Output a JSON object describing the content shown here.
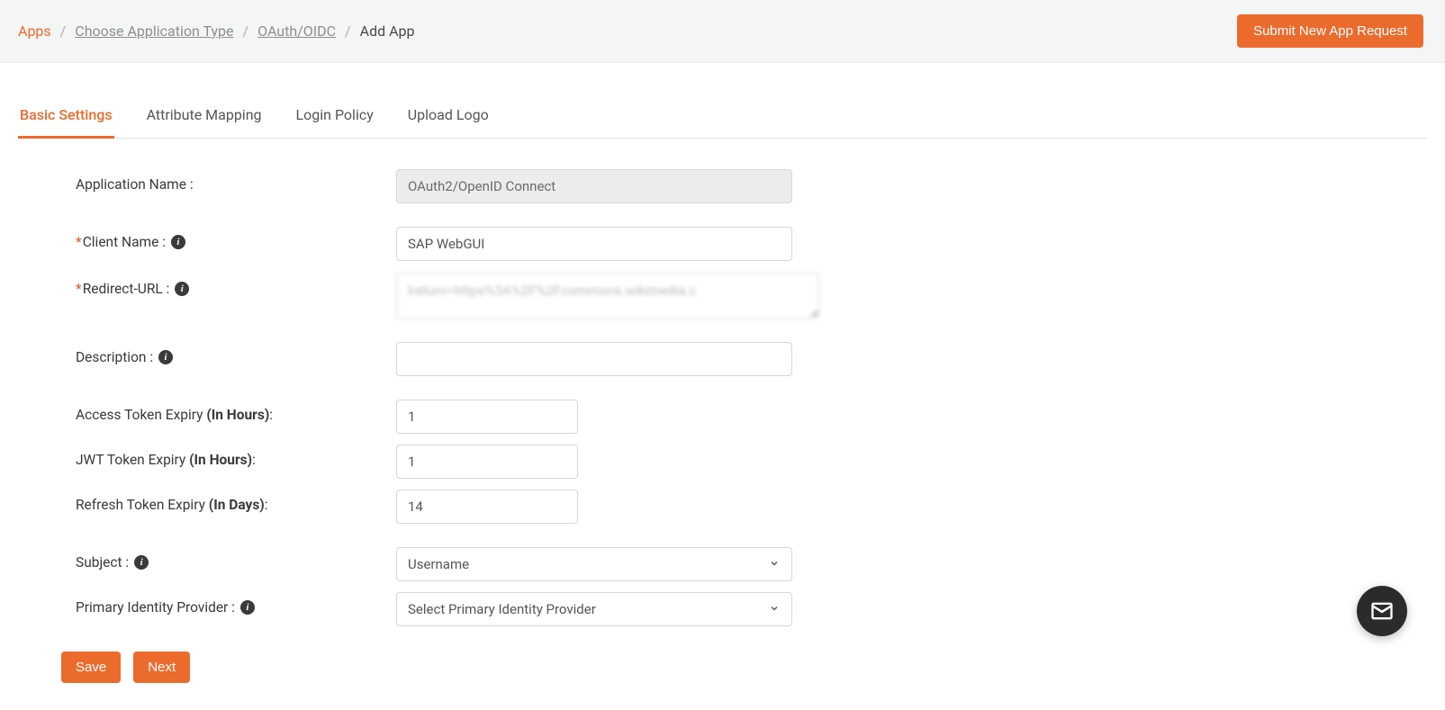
{
  "header": {
    "breadcrumb": {
      "apps": "Apps",
      "choose": "Choose Application Type",
      "oauth": "OAuth/OIDC",
      "current": "Add App",
      "sep": "/"
    },
    "submit_btn": "Submit New App Request"
  },
  "tabs": {
    "basic": "Basic Settings",
    "attribute": "Attribute Mapping",
    "login": "Login Policy",
    "upload": "Upload Logo"
  },
  "form": {
    "app_name": {
      "label": "Application Name :",
      "value": "OAuth2/OpenID Connect"
    },
    "client_name": {
      "label": "Client Name :",
      "value": "SAP WebGUI"
    },
    "redirect_url": {
      "label": "Redirect-URL :",
      "value": "lreturn=https%3A%2F%2Fcommons.wikimedia.c"
    },
    "description": {
      "label": "Description :",
      "value": ""
    },
    "access_token": {
      "label_pre": "Access Token Expiry ",
      "label_bold": "(In Hours)",
      "label_post": ":",
      "value": "1"
    },
    "jwt_token": {
      "label_pre": "JWT Token Expiry ",
      "label_bold": "(In Hours)",
      "label_post": ":",
      "value": "1"
    },
    "refresh_token": {
      "label_pre": "Refresh Token Expiry ",
      "label_bold": "(In Days)",
      "label_post": ":",
      "value": "14"
    },
    "subject": {
      "label": "Subject :",
      "value": "Username"
    },
    "primary_idp": {
      "label": "Primary Identity Provider :",
      "value": "Select Primary Identity Provider"
    }
  },
  "buttons": {
    "save": "Save",
    "next": "Next"
  }
}
